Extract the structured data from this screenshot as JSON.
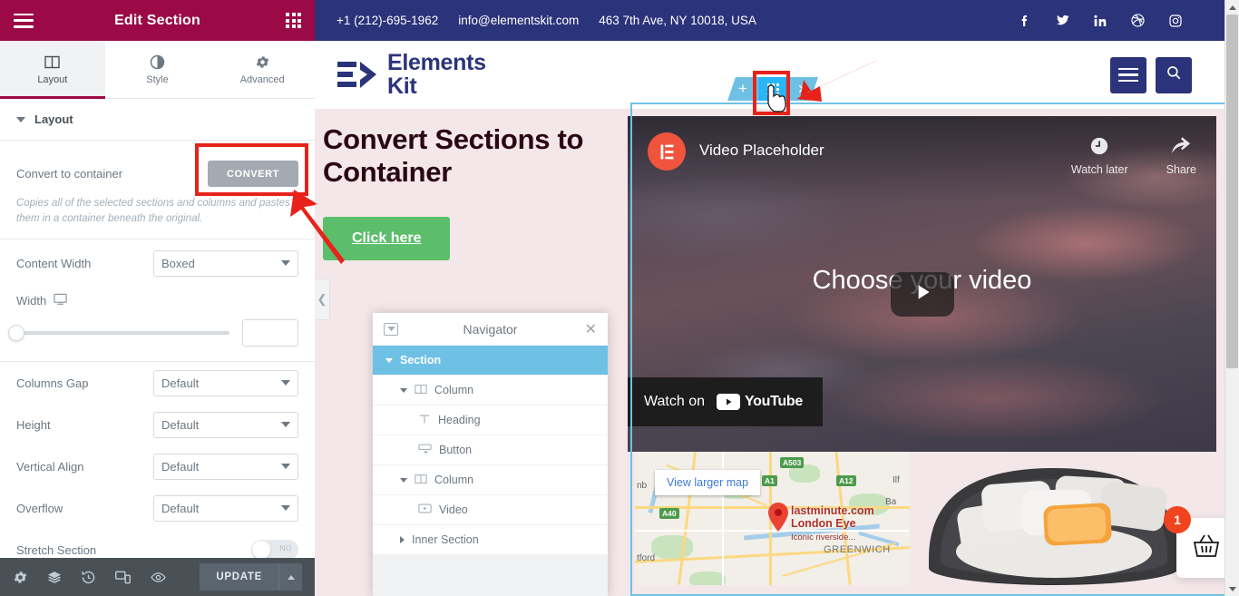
{
  "panel": {
    "header": {
      "title": "Edit Section",
      "menu_icon": "hamburger-icon",
      "apps_icon": "grid-icon"
    },
    "tabs": [
      {
        "label": "Layout",
        "icon": "columns-icon",
        "active": true
      },
      {
        "label": "Style",
        "icon": "contrast-icon",
        "active": false
      },
      {
        "label": "Advanced",
        "icon": "gear-icon",
        "active": false
      }
    ],
    "section_title": "Layout",
    "convert": {
      "label": "Convert to container",
      "button": "CONVERT",
      "description": "Copies all of the selected sections and columns and pastes them in a container beneath the original."
    },
    "controls": [
      {
        "label": "Content Width",
        "value": "Boxed"
      },
      {
        "label": "Columns Gap",
        "value": "Default"
      },
      {
        "label": "Height",
        "value": "Default"
      },
      {
        "label": "Vertical Align",
        "value": "Default"
      },
      {
        "label": "Overflow",
        "value": "Default"
      }
    ],
    "width": {
      "label": "Width",
      "device_icon": "desktop-icon",
      "value": ""
    },
    "stretch": {
      "label": "Stretch Section",
      "state": "NO"
    },
    "footer": {
      "icons": [
        "gear-icon",
        "layers-icon",
        "history-icon",
        "responsive-icon",
        "preview-icon"
      ],
      "update_label": "UPDATE",
      "caret_icon": "chevron-up-icon"
    },
    "collapse_icon": "chevron-left-icon"
  },
  "site": {
    "topbar": {
      "phone": "+1 (212)-695-1962",
      "email": "info@elementskit.com",
      "address": "463 7th Ave, NY 10018, USA",
      "socials": [
        "facebook-icon",
        "twitter-icon",
        "linkedin-icon",
        "dribbble-icon",
        "instagram-icon"
      ]
    },
    "logo": {
      "line1": "Elements",
      "line2": "Kit"
    },
    "nav_buttons": [
      "hamburger-menu-button",
      "search-button"
    ],
    "section_handle": {
      "add_icon": "plus-icon",
      "edit_icon": "grid-handle-icon",
      "close_icon": "close-icon"
    },
    "hero": {
      "heading": "Convert Sections to Container",
      "button": "Click here"
    },
    "video": {
      "title": "Video Placeholder",
      "watch_later": "Watch later",
      "share": "Share",
      "center_text": "Choose your video",
      "watch_on": "Watch on",
      "youtube": "YouTube"
    },
    "map": {
      "view_larger": "View larger map",
      "place_title_1": "lastminute.com",
      "place_title_2": "London Eye",
      "place_sub": "Iconic riverside...",
      "labels": [
        "GREENWICH",
        "tford",
        "nb",
        "Ba",
        "Ilf"
      ],
      "shields": [
        "A503",
        "A1",
        "A12",
        "A40"
      ]
    },
    "product": {
      "cart_count": "1",
      "cart_icon": "basket-icon"
    }
  },
  "navigator": {
    "title": "Navigator",
    "dock_icon": "dock-icon",
    "close_icon": "close-icon",
    "items": [
      {
        "label": "Section",
        "indent": 0,
        "icon": "",
        "selected": true,
        "arrow": "down"
      },
      {
        "label": "Column",
        "indent": 1,
        "icon": "columns-icon",
        "selected": false,
        "arrow": "down"
      },
      {
        "label": "Heading",
        "indent": 2,
        "icon": "text-icon",
        "selected": false,
        "arrow": ""
      },
      {
        "label": "Button",
        "indent": 2,
        "icon": "button-icon",
        "selected": false,
        "arrow": ""
      },
      {
        "label": "Column",
        "indent": 1,
        "icon": "columns-icon",
        "selected": false,
        "arrow": "down"
      },
      {
        "label": "Video",
        "indent": 2,
        "icon": "video-icon",
        "selected": false,
        "arrow": ""
      },
      {
        "label": "Inner Section",
        "indent": 1,
        "icon": "",
        "selected": false,
        "arrow": "right"
      }
    ]
  },
  "colors": {
    "panel_header": "#9b0a46",
    "topbar": "#2b337a",
    "accent_blue": "#6ec1e4",
    "handle_active": "#29b6f6",
    "hero_bg": "#f3e7e9",
    "heading": "#2b0714",
    "cta_green": "#5cbe6b",
    "annotation_red": "#e8221a",
    "convert_btn": "#a4aab2",
    "cart_badge": "#f0441f"
  }
}
